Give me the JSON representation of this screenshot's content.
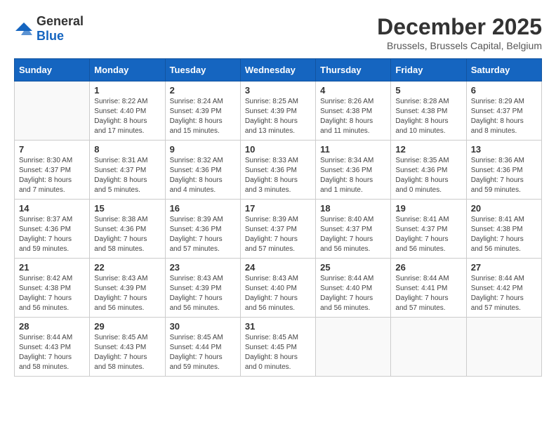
{
  "logo": {
    "general": "General",
    "blue": "Blue"
  },
  "title": "December 2025",
  "subtitle": "Brussels, Brussels Capital, Belgium",
  "days_header": [
    "Sunday",
    "Monday",
    "Tuesday",
    "Wednesday",
    "Thursday",
    "Friday",
    "Saturday"
  ],
  "weeks": [
    [
      {
        "day": "",
        "sunrise": "",
        "sunset": "",
        "daylight": ""
      },
      {
        "day": "1",
        "sunrise": "Sunrise: 8:22 AM",
        "sunset": "Sunset: 4:40 PM",
        "daylight": "Daylight: 8 hours and 17 minutes."
      },
      {
        "day": "2",
        "sunrise": "Sunrise: 8:24 AM",
        "sunset": "Sunset: 4:39 PM",
        "daylight": "Daylight: 8 hours and 15 minutes."
      },
      {
        "day": "3",
        "sunrise": "Sunrise: 8:25 AM",
        "sunset": "Sunset: 4:39 PM",
        "daylight": "Daylight: 8 hours and 13 minutes."
      },
      {
        "day": "4",
        "sunrise": "Sunrise: 8:26 AM",
        "sunset": "Sunset: 4:38 PM",
        "daylight": "Daylight: 8 hours and 11 minutes."
      },
      {
        "day": "5",
        "sunrise": "Sunrise: 8:28 AM",
        "sunset": "Sunset: 4:38 PM",
        "daylight": "Daylight: 8 hours and 10 minutes."
      },
      {
        "day": "6",
        "sunrise": "Sunrise: 8:29 AM",
        "sunset": "Sunset: 4:37 PM",
        "daylight": "Daylight: 8 hours and 8 minutes."
      }
    ],
    [
      {
        "day": "7",
        "sunrise": "Sunrise: 8:30 AM",
        "sunset": "Sunset: 4:37 PM",
        "daylight": "Daylight: 8 hours and 7 minutes."
      },
      {
        "day": "8",
        "sunrise": "Sunrise: 8:31 AM",
        "sunset": "Sunset: 4:37 PM",
        "daylight": "Daylight: 8 hours and 5 minutes."
      },
      {
        "day": "9",
        "sunrise": "Sunrise: 8:32 AM",
        "sunset": "Sunset: 4:36 PM",
        "daylight": "Daylight: 8 hours and 4 minutes."
      },
      {
        "day": "10",
        "sunrise": "Sunrise: 8:33 AM",
        "sunset": "Sunset: 4:36 PM",
        "daylight": "Daylight: 8 hours and 3 minutes."
      },
      {
        "day": "11",
        "sunrise": "Sunrise: 8:34 AM",
        "sunset": "Sunset: 4:36 PM",
        "daylight": "Daylight: 8 hours and 1 minute."
      },
      {
        "day": "12",
        "sunrise": "Sunrise: 8:35 AM",
        "sunset": "Sunset: 4:36 PM",
        "daylight": "Daylight: 8 hours and 0 minutes."
      },
      {
        "day": "13",
        "sunrise": "Sunrise: 8:36 AM",
        "sunset": "Sunset: 4:36 PM",
        "daylight": "Daylight: 7 hours and 59 minutes."
      }
    ],
    [
      {
        "day": "14",
        "sunrise": "Sunrise: 8:37 AM",
        "sunset": "Sunset: 4:36 PM",
        "daylight": "Daylight: 7 hours and 59 minutes."
      },
      {
        "day": "15",
        "sunrise": "Sunrise: 8:38 AM",
        "sunset": "Sunset: 4:36 PM",
        "daylight": "Daylight: 7 hours and 58 minutes."
      },
      {
        "day": "16",
        "sunrise": "Sunrise: 8:39 AM",
        "sunset": "Sunset: 4:36 PM",
        "daylight": "Daylight: 7 hours and 57 minutes."
      },
      {
        "day": "17",
        "sunrise": "Sunrise: 8:39 AM",
        "sunset": "Sunset: 4:37 PM",
        "daylight": "Daylight: 7 hours and 57 minutes."
      },
      {
        "day": "18",
        "sunrise": "Sunrise: 8:40 AM",
        "sunset": "Sunset: 4:37 PM",
        "daylight": "Daylight: 7 hours and 56 minutes."
      },
      {
        "day": "19",
        "sunrise": "Sunrise: 8:41 AM",
        "sunset": "Sunset: 4:37 PM",
        "daylight": "Daylight: 7 hours and 56 minutes."
      },
      {
        "day": "20",
        "sunrise": "Sunrise: 8:41 AM",
        "sunset": "Sunset: 4:38 PM",
        "daylight": "Daylight: 7 hours and 56 minutes."
      }
    ],
    [
      {
        "day": "21",
        "sunrise": "Sunrise: 8:42 AM",
        "sunset": "Sunset: 4:38 PM",
        "daylight": "Daylight: 7 hours and 56 minutes."
      },
      {
        "day": "22",
        "sunrise": "Sunrise: 8:43 AM",
        "sunset": "Sunset: 4:39 PM",
        "daylight": "Daylight: 7 hours and 56 minutes."
      },
      {
        "day": "23",
        "sunrise": "Sunrise: 8:43 AM",
        "sunset": "Sunset: 4:39 PM",
        "daylight": "Daylight: 7 hours and 56 minutes."
      },
      {
        "day": "24",
        "sunrise": "Sunrise: 8:43 AM",
        "sunset": "Sunset: 4:40 PM",
        "daylight": "Daylight: 7 hours and 56 minutes."
      },
      {
        "day": "25",
        "sunrise": "Sunrise: 8:44 AM",
        "sunset": "Sunset: 4:40 PM",
        "daylight": "Daylight: 7 hours and 56 minutes."
      },
      {
        "day": "26",
        "sunrise": "Sunrise: 8:44 AM",
        "sunset": "Sunset: 4:41 PM",
        "daylight": "Daylight: 7 hours and 57 minutes."
      },
      {
        "day": "27",
        "sunrise": "Sunrise: 8:44 AM",
        "sunset": "Sunset: 4:42 PM",
        "daylight": "Daylight: 7 hours and 57 minutes."
      }
    ],
    [
      {
        "day": "28",
        "sunrise": "Sunrise: 8:44 AM",
        "sunset": "Sunset: 4:43 PM",
        "daylight": "Daylight: 7 hours and 58 minutes."
      },
      {
        "day": "29",
        "sunrise": "Sunrise: 8:45 AM",
        "sunset": "Sunset: 4:43 PM",
        "daylight": "Daylight: 7 hours and 58 minutes."
      },
      {
        "day": "30",
        "sunrise": "Sunrise: 8:45 AM",
        "sunset": "Sunset: 4:44 PM",
        "daylight": "Daylight: 7 hours and 59 minutes."
      },
      {
        "day": "31",
        "sunrise": "Sunrise: 8:45 AM",
        "sunset": "Sunset: 4:45 PM",
        "daylight": "Daylight: 8 hours and 0 minutes."
      },
      {
        "day": "",
        "sunrise": "",
        "sunset": "",
        "daylight": ""
      },
      {
        "day": "",
        "sunrise": "",
        "sunset": "",
        "daylight": ""
      },
      {
        "day": "",
        "sunrise": "",
        "sunset": "",
        "daylight": ""
      }
    ]
  ]
}
